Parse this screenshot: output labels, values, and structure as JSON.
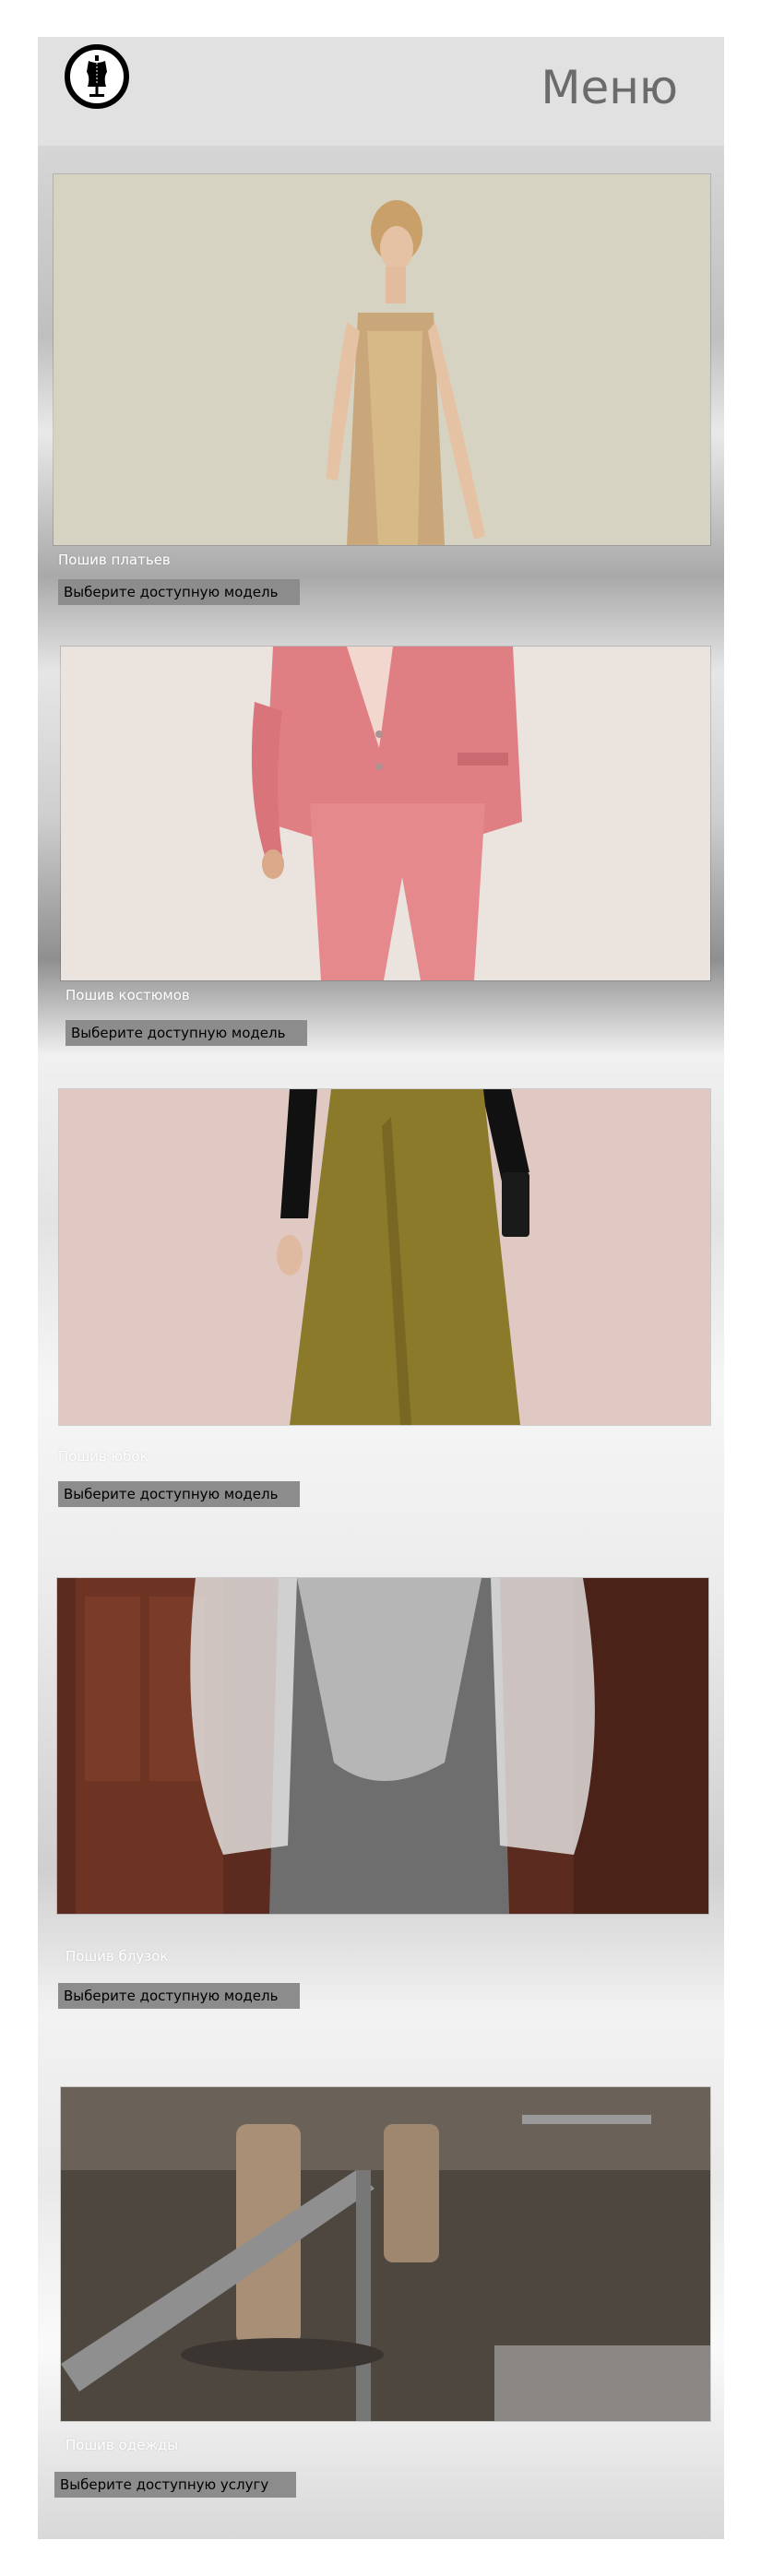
{
  "header": {
    "menu_label": "Меню",
    "logo_icon": "dress-form-icon"
  },
  "sections": [
    {
      "category": "Пошив платьев",
      "button": "Выберите доступную модель"
    },
    {
      "category": "Пошив костюмов",
      "button": "Выберите доступную модель"
    },
    {
      "category": "Пошив юбок",
      "button": "Выберите доступную модель"
    },
    {
      "category": "Пошив блузок",
      "button": "Выберите доступную модель"
    },
    {
      "category": "Пошив одежды",
      "button": "Выберите доступную услугу"
    }
  ],
  "colors": {
    "header_bg": "#e1e1e1",
    "menu_text": "#6b6b6b",
    "button_bg": "#8c8c8c"
  }
}
